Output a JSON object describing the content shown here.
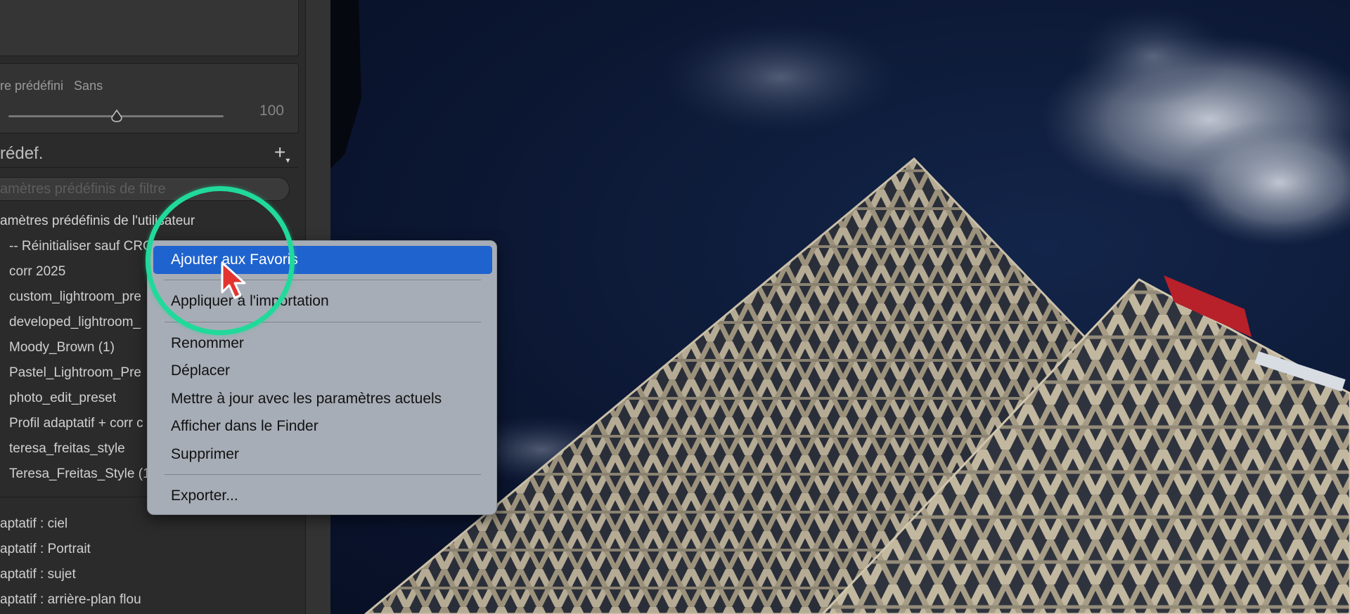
{
  "panel": {
    "amount_label": "re prédéfini   Sans",
    "amount_value": "100",
    "presets_title": "rédef.",
    "filter_placeholder": "amètres prédéfinis de filtre",
    "user_group_title": "amètres prédéfinis de l'utilisateur",
    "user_presets": [
      "-- Réinitialiser sauf CRO",
      "corr 2025",
      "custom_lightroom_pre",
      "developed_lightroom_",
      "Moody_Brown (1)",
      "Pastel_Lightroom_Pre",
      "photo_edit_preset",
      "Profil adaptatif + corr c",
      "teresa_freitas_style",
      "Teresa_Freitas_Style (1"
    ],
    "adaptive_presets": [
      "aptatif : ciel",
      "aptatif : Portrait",
      "aptatif : sujet",
      "aptatif : arrière-plan flou"
    ]
  },
  "context_menu": {
    "items": [
      "Ajouter aux Favoris",
      "Appliquer à l'importation",
      "Renommer",
      "Déplacer",
      "Mettre à jour avec les paramètres actuels",
      "Afficher dans le Finder",
      "Supprimer",
      "Exporter..."
    ],
    "active_item": "Ajouter aux Favoris"
  },
  "colors": {
    "highlight_ring": "#21d99a",
    "menu_selected": "#1f63cf",
    "sky": "#0b1631",
    "cursor": "#e3342f"
  },
  "icons": {
    "add_preset": "plus-dropdown-icon",
    "slider_thumb": "triangle-thumb-icon",
    "cursor": "arrow-pointer-icon"
  }
}
